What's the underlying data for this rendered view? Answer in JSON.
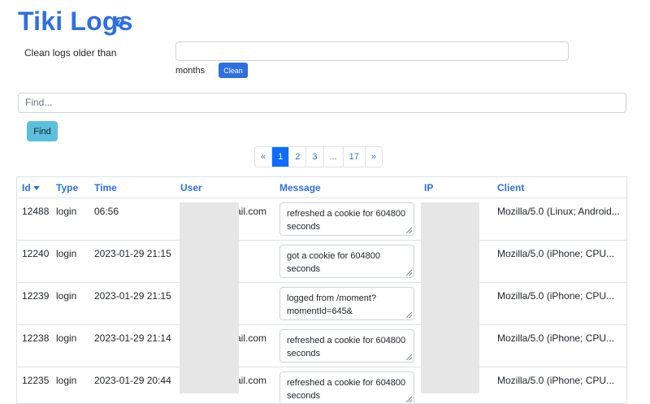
{
  "header": {
    "title": "Tiki Logs",
    "help_glyph": "?"
  },
  "clean": {
    "label": "Clean logs older than",
    "value": "",
    "unit": "months",
    "button_label": "Clean"
  },
  "search": {
    "placeholder": "Find...",
    "button_label": "Find"
  },
  "pagination": {
    "items": [
      "«",
      "1",
      "2",
      "3",
      "...",
      "17",
      "»"
    ],
    "active": "1"
  },
  "table": {
    "columns": {
      "id": "Id",
      "type": "Type",
      "time": "Time",
      "user": "User",
      "message": "Message",
      "ip": "IP",
      "client": "Client"
    },
    "sort_column": "Id",
    "rows": [
      {
        "id": "12488",
        "type": "login",
        "time": "06:56",
        "user": "ail.com",
        "message": "refreshed a cookie for 604800 seconds",
        "ip": "",
        "client": "Mozilla/5.0 (Linux; Android..."
      },
      {
        "id": "12240",
        "type": "login",
        "time": "2023-01-29 21:15",
        "user": "",
        "message": "got a cookie for 604800 seconds",
        "ip": "",
        "client": "Mozilla/5.0 (iPhone; CPU..."
      },
      {
        "id": "12239",
        "type": "login",
        "time": "2023-01-29 21:15",
        "user": "",
        "message": "logged from /moment?momentId=645&",
        "ip": "",
        "client": "Mozilla/5.0 (iPhone; CPU..."
      },
      {
        "id": "12238",
        "type": "login",
        "time": "2023-01-29 21:14",
        "user": "ail.com",
        "message": "refreshed a cookie for 604800 seconds",
        "ip": "",
        "client": "Mozilla/5.0 (iPhone; CPU..."
      },
      {
        "id": "12235",
        "type": "login",
        "time": "2023-01-29 20:44",
        "user": "ail.com",
        "message": "refreshed a cookie for 604800 seconds",
        "ip": "",
        "client": "Mozilla/5.0 (iPhone; CPU..."
      }
    ]
  },
  "colors": {
    "accent": "#2f6fe0",
    "find_button": "#5bc0de",
    "active_page": "#0d6efd",
    "redaction": "#e6e6e6"
  }
}
